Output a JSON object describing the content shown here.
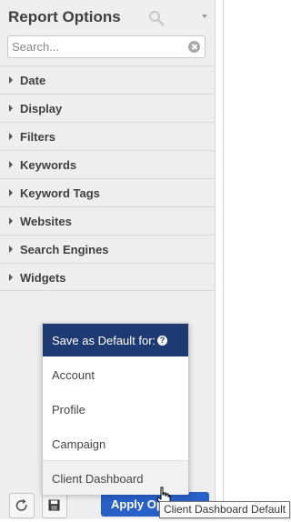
{
  "panel": {
    "title": "Report Options",
    "search": {
      "placeholder": "Search...",
      "value": ""
    }
  },
  "sections": [
    {
      "label": "Date"
    },
    {
      "label": "Display"
    },
    {
      "label": "Filters"
    },
    {
      "label": "Keywords"
    },
    {
      "label": "Keyword Tags"
    },
    {
      "label": "Websites"
    },
    {
      "label": "Search Engines"
    },
    {
      "label": "Widgets"
    }
  ],
  "save_default_menu": {
    "header": "Save as Default for:",
    "items": [
      "Account",
      "Profile",
      "Campaign",
      "Client Dashboard"
    ],
    "hovered": "Client Dashboard"
  },
  "footer": {
    "apply_label": "Apply Options",
    "tooltip": "Client Dashboard Default"
  },
  "colors": {
    "panel_bg": "#eeeeee",
    "menu_header_bg": "#1e3a73",
    "apply_bg": "#2860c8"
  },
  "icons": [
    "search-icon",
    "caret-down-icon",
    "clear-icon",
    "expand-arrow-icon",
    "help-icon",
    "refresh-icon",
    "save-disk-icon",
    "hand-cursor-icon"
  ]
}
